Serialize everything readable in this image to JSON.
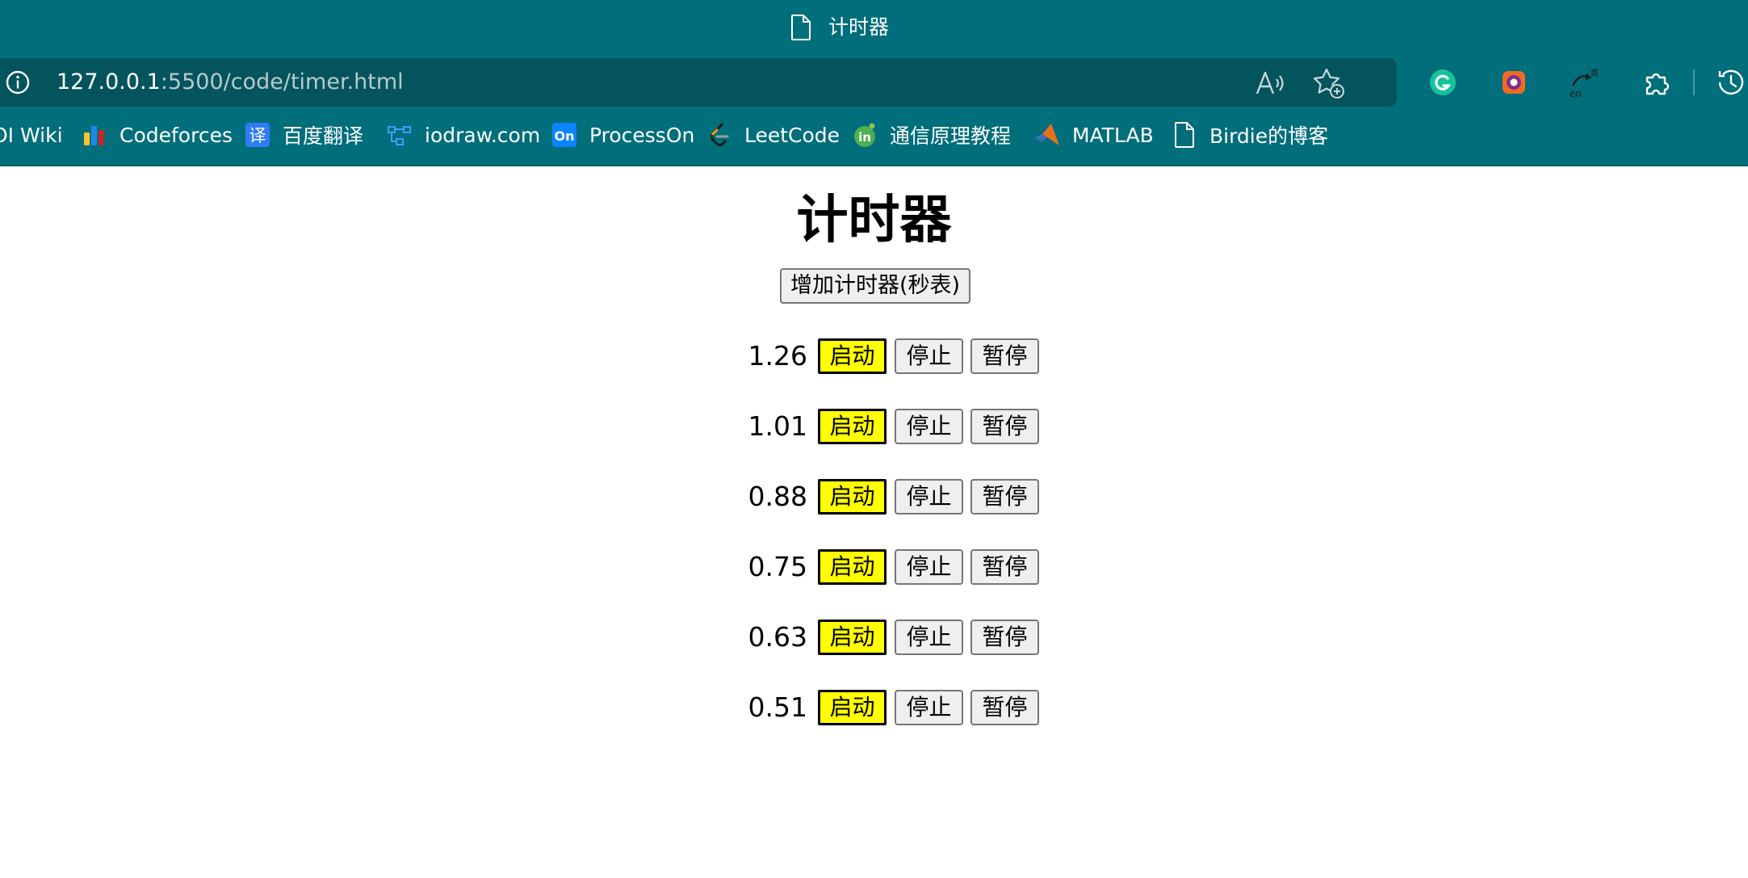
{
  "browser": {
    "tab_title": "计时器",
    "url_host": "127.0.0.1",
    "url_path": ":5500/code/timer.html",
    "accent": "#016e7b",
    "bookmarks": [
      {
        "label": "OI Wiki",
        "icon": "oi-wiki-icon"
      },
      {
        "label": "Codeforces",
        "icon": "codeforces-icon"
      },
      {
        "label": "百度翻译",
        "icon": "baidu-translate-icon"
      },
      {
        "label": "iodraw.com",
        "icon": "iodraw-icon"
      },
      {
        "label": "ProcessOn",
        "icon": "processon-icon"
      },
      {
        "label": "LeetCode",
        "icon": "leetcode-icon"
      },
      {
        "label": "通信原理教程",
        "icon": "course-icon"
      },
      {
        "label": "MATLAB",
        "icon": "matlab-icon"
      },
      {
        "label": "Birdie的博客",
        "icon": "document-icon"
      }
    ]
  },
  "page": {
    "heading": "计时器",
    "add_button": "增加计时器(秒表)",
    "start_color": "#ffff00",
    "timers": [
      {
        "value": "1.26",
        "start": "启动",
        "stop": "停止",
        "pause": "暂停"
      },
      {
        "value": "1.01",
        "start": "启动",
        "stop": "停止",
        "pause": "暂停"
      },
      {
        "value": "0.88",
        "start": "启动",
        "stop": "停止",
        "pause": "暂停"
      },
      {
        "value": "0.75",
        "start": "启动",
        "stop": "停止",
        "pause": "暂停"
      },
      {
        "value": "0.63",
        "start": "启动",
        "stop": "停止",
        "pause": "暂停"
      },
      {
        "value": "0.51",
        "start": "启动",
        "stop": "停止",
        "pause": "暂停"
      }
    ]
  }
}
